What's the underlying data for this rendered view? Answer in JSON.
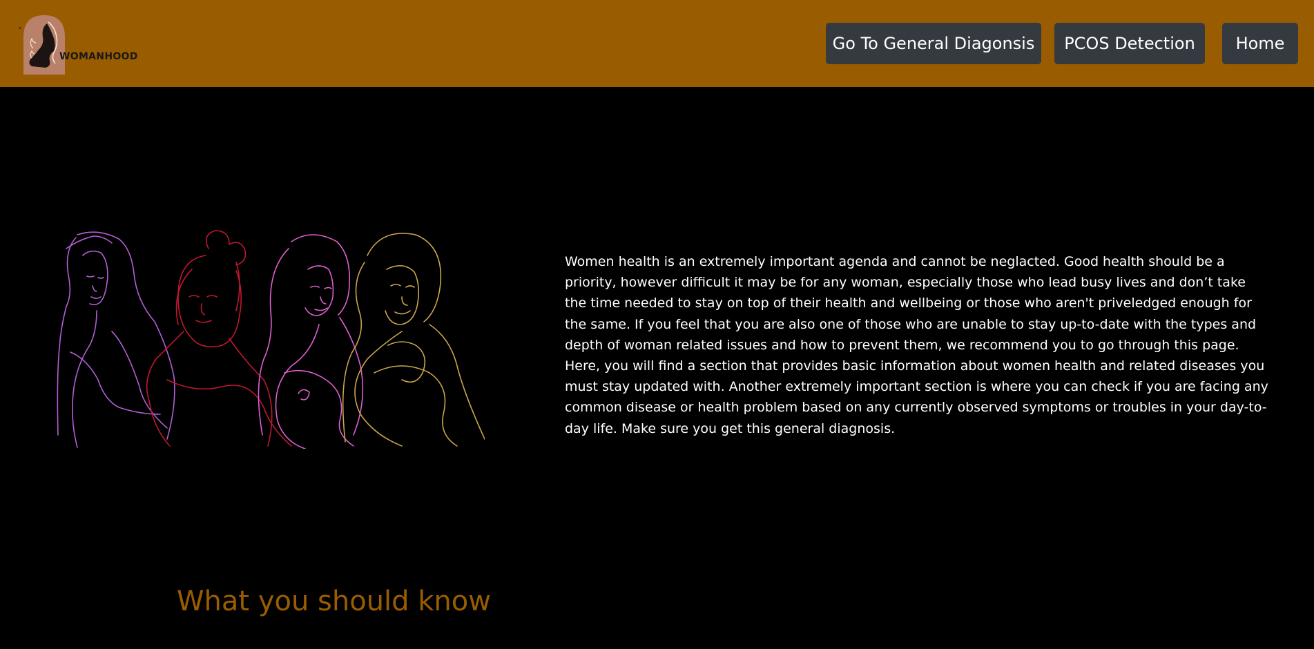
{
  "brand": {
    "logo_text": "WOMANHOOD",
    "logo_icon": "woman-silhouette-logo-icon"
  },
  "nav": {
    "general_diagnosis_label": "Go To General Diagonsis",
    "pcos_label": "PCOS Detection",
    "home_label": "Home"
  },
  "hero": {
    "illustration_icon": "women-line-art-illustration",
    "intro_text": "Women health is an extremely important agenda and cannot be neglacted. Good health should be a priority, however difficult it may be for any woman, especially those who lead busy lives and don’t take the time needed to stay on top of their health and wellbeing or those who aren't priveledged enough for the same. If you feel that you are also one of those who are unable to stay up-to-date with the types and depth of woman related issues and how to prevent them, we recommend you to go through this page. Here, you will find a section that provides basic information about women health and related diseases you must stay updated with. Another extremely important section is where you can check if you are facing any common disease or health problem based on any currently observed symptoms or troubles in your day-to-day life. Make sure you get this general diagnosis."
  },
  "section": {
    "heading": "What you should know"
  },
  "colors": {
    "navbar_bg": "#9a5c00",
    "button_bg": "#343a40",
    "page_bg": "#000000",
    "heading_accent": "#9a5c00",
    "line_purple": "#b35fd6",
    "line_red": "#c0182e",
    "line_pink": "#e05fd0",
    "line_gold": "#c9a64a"
  }
}
